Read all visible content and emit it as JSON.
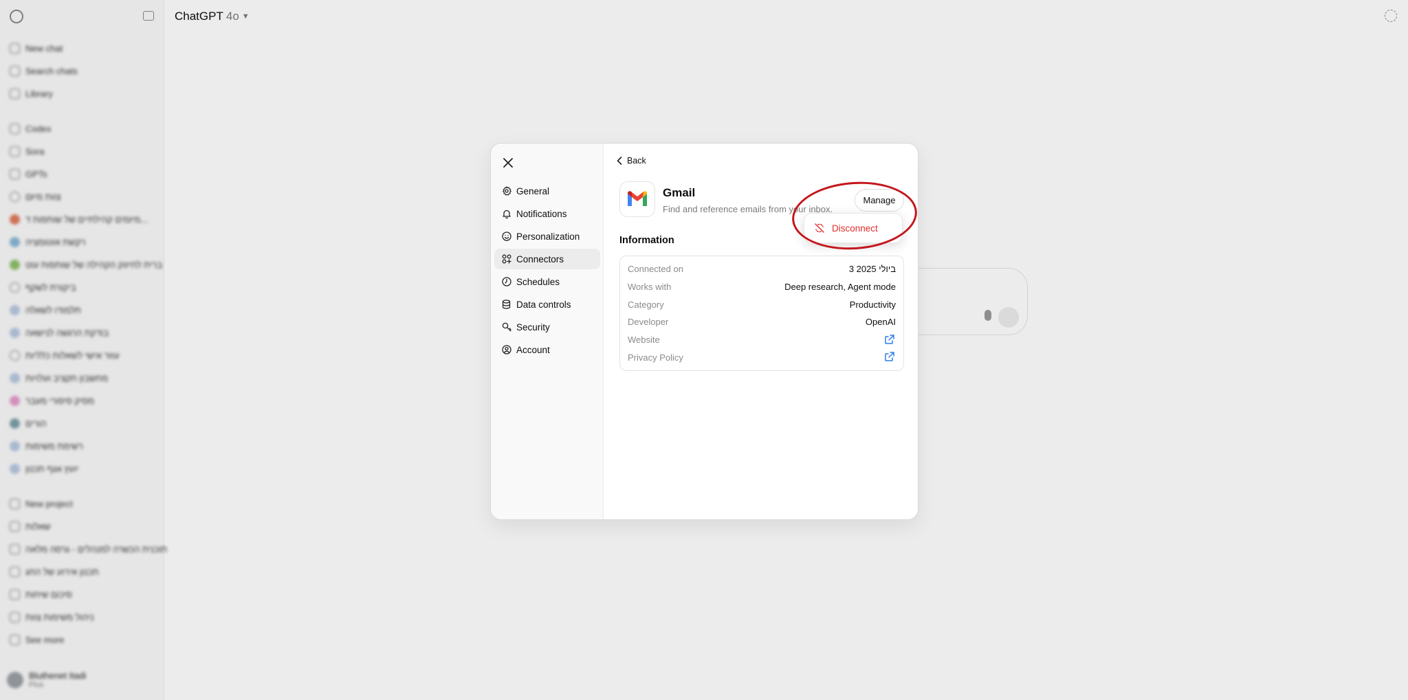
{
  "app": {
    "title": "ChatGPT",
    "model": "4o",
    "chevron": "chevron-down-icon"
  },
  "sidebar": {
    "items": [
      {
        "label": "New chat",
        "icon": "edit-icon"
      },
      {
        "label": "Search chats",
        "icon": "search-icon"
      },
      {
        "label": "Library",
        "icon": "library-icon"
      },
      {
        "label": "Codex",
        "icon": "codex-icon"
      },
      {
        "label": "Sora",
        "icon": "sora-icon"
      },
      {
        "label": "GPTs",
        "icon": "gpts-icon"
      },
      {
        "label": "צוות מיזם",
        "icon": "gpt-icon"
      },
      {
        "label": "מיזמים קהילתיים של שותפות ד...",
        "icon": "gpt-avatar",
        "color": "#e07a5f"
      },
      {
        "label": "רקשת אוטומציה",
        "icon": "gpt-avatar",
        "color": "#8ab6d6"
      },
      {
        "label": "ברית לחיזוק הקהילה של שותפות עוט",
        "icon": "gpt-avatar",
        "color": "#8fbf6a"
      },
      {
        "label": "ביקורת לשקף",
        "icon": "gpt-icon"
      },
      {
        "label": "תלמודו לשאלה",
        "icon": "gpt-avatar",
        "color": "#b8c7e0"
      },
      {
        "label": "בודקת הרגשה לנישאה",
        "icon": "gpt-avatar",
        "color": "#b8c7e0"
      },
      {
        "label": "עוזר אישי לשאלות כלליות",
        "icon": "gpt-icon"
      },
      {
        "label": "מחשבון תקציב ועלויות",
        "icon": "gpt-avatar",
        "color": "#b8c7e0"
      },
      {
        "label": "מסיק סיפורי מעבר",
        "icon": "gpt-avatar",
        "color": "#e59ac9"
      },
      {
        "label": "הורים",
        "icon": "gpt-avatar",
        "color": "#7aa0a8"
      },
      {
        "label": "רשימת משימות",
        "icon": "gpt-avatar",
        "color": "#b8c7e0"
      },
      {
        "label": "יועץ אגף תכנון",
        "icon": "gpt-avatar",
        "color": "#b8c7e0"
      },
      {
        "label": "New project",
        "icon": "folder-plus-icon"
      },
      {
        "label": "שאלות",
        "icon": "folder-icon"
      },
      {
        "label": "תוכנית הכשרה למנהלים - גרסה מלאה",
        "icon": "folder-icon"
      },
      {
        "label": "תכנון אירוע של החג",
        "icon": "folder-icon"
      },
      {
        "label": "סיכום שיחות",
        "icon": "folder-icon"
      },
      {
        "label": "ניהול משימות צוות",
        "icon": "folder-icon"
      },
      {
        "label": "See more",
        "icon": "ellipsis-icon"
      }
    ],
    "profile": {
      "name": "Bluthenet Itadi",
      "plan": "Plus"
    }
  },
  "settings": {
    "close_icon": "close-icon",
    "nav": [
      {
        "label": "General",
        "icon": "gear-icon"
      },
      {
        "label": "Notifications",
        "icon": "bell-icon"
      },
      {
        "label": "Personalization",
        "icon": "personalization-icon"
      },
      {
        "label": "Connectors",
        "icon": "connectors-icon",
        "active": true
      },
      {
        "label": "Schedules",
        "icon": "clock-icon"
      },
      {
        "label": "Data controls",
        "icon": "database-icon"
      },
      {
        "label": "Security",
        "icon": "security-icon"
      },
      {
        "label": "Account",
        "icon": "user-icon"
      }
    ],
    "connector": {
      "back_label": "Back",
      "name": "Gmail",
      "description": "Find and reference emails from your inbox.",
      "manage_label": "Manage",
      "menu": {
        "disconnect_label": "Disconnect",
        "disconnect_color": "#e02e2a"
      },
      "info_title": "Information",
      "info": [
        {
          "label": "Connected on",
          "value": "3 ביולי 2025"
        },
        {
          "label": "Works with",
          "value": "Deep research, Agent mode"
        },
        {
          "label": "Category",
          "value": "Productivity"
        },
        {
          "label": "Developer",
          "value": "OpenAI"
        },
        {
          "label": "Website",
          "link_icon": "external-link-icon"
        },
        {
          "label": "Privacy Policy",
          "link_icon": "external-link-icon"
        }
      ]
    }
  },
  "annotation": {
    "color": "#c4161c"
  }
}
